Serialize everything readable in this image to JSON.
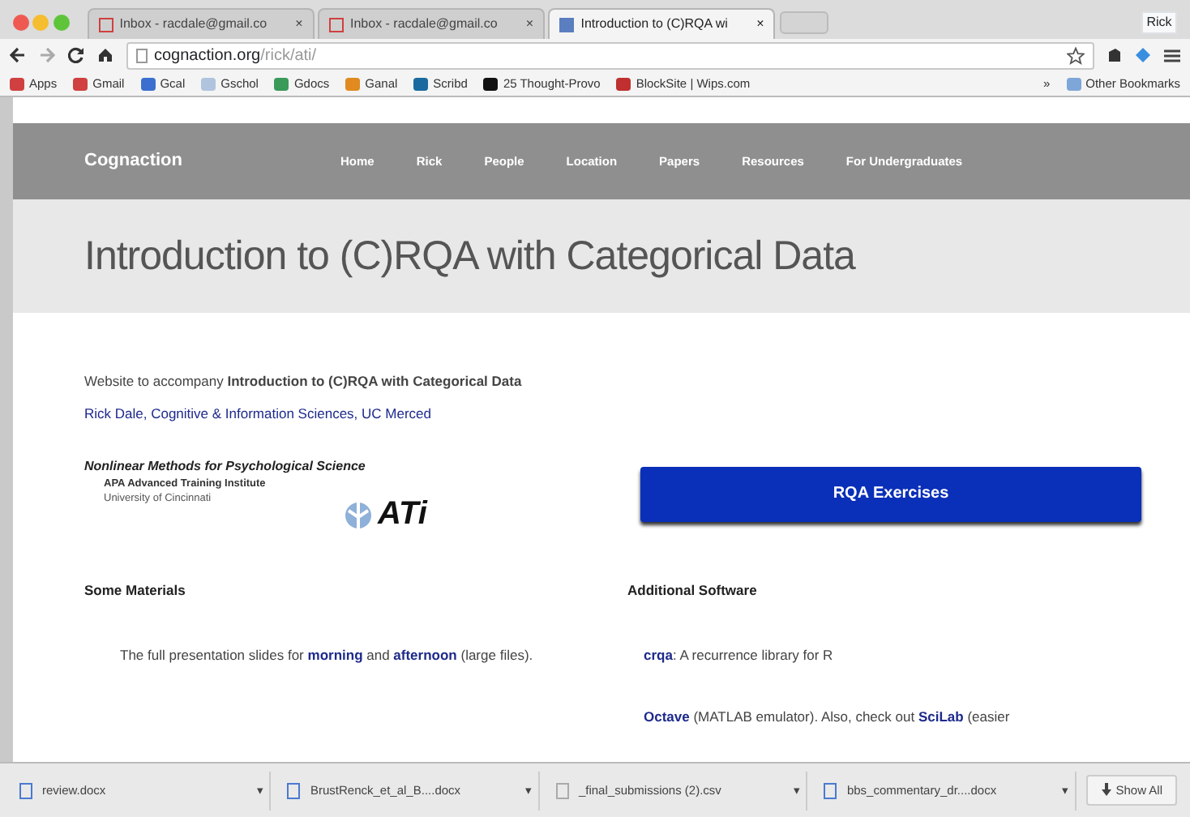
{
  "browser": {
    "tabs": [
      {
        "title": "Inbox - racdale@gmail.co",
        "kind": "mail",
        "selected": false
      },
      {
        "title": "Inbox - racdale@gmail.co",
        "kind": "mail",
        "selected": false
      },
      {
        "title": "Introduction to (C)RQA wi",
        "kind": "page",
        "selected": true
      }
    ],
    "tab_close": "×",
    "profile": "Rick",
    "url_host": "cognaction.org",
    "url_path": "/rick/ati/",
    "bookmarks": [
      {
        "label": "Apps",
        "color": "#d04040"
      },
      {
        "label": "Gmail",
        "color": "#d04040"
      },
      {
        "label": "Gcal",
        "color": "#3a6fd0"
      },
      {
        "label": "Gschol",
        "color": "#b0c4de"
      },
      {
        "label": "Gdocs",
        "color": "#3a9a5a"
      },
      {
        "label": "Ganal",
        "color": "#e08a20"
      },
      {
        "label": "Scribd",
        "color": "#1a6aa0"
      },
      {
        "label": "25 Thought-Provo",
        "color": "#111111"
      },
      {
        "label": "BlockSite | Wips.com",
        "color": "#c03030"
      }
    ],
    "more_bookmarks": "»",
    "other_bookmarks": "Other Bookmarks"
  },
  "site": {
    "brand": "Cognaction",
    "nav": [
      "Home",
      "Rick",
      "People",
      "Location",
      "Papers",
      "Resources",
      "For Undergraduates"
    ],
    "title": "Introduction to (C)RQA with Categorical Data",
    "intro": "Website to accompany **Introduction to (C)RQA with Categorical Data**",
    "author": "Rick Dale, Cognitive & Information Sciences, UC Merced",
    "logo": {
      "heading": "Nonlinear Methods for Psychological Science",
      "line1": "APA Advanced Training Institute",
      "line2": "University of Cincinnati",
      "mark": "ATi"
    },
    "button": "RQA Exercises",
    "sections": [
      {
        "heading": "Some Materials",
        "paragraphs": [
          [
            {
              "text": "The full presentation slides for ",
              "link": false
            },
            {
              "text": "morning",
              "link": true
            },
            {
              "text": " and ",
              "link": false
            },
            {
              "text": "afternoon",
              "link": true
            },
            {
              "text": " (large files).",
              "link": false
            }
          ]
        ]
      },
      {
        "heading": "Additional Software",
        "paragraphs": [
          [
            {
              "text": "crqa",
              "link": true
            },
            {
              "text": ": A recurrence library for R",
              "link": false
            }
          ],
          [
            {
              "text": "Octave",
              "link": true
            },
            {
              "text": " (MATLAB emulator). Also, check out ",
              "link": false
            },
            {
              "text": "SciLab",
              "link": true
            },
            {
              "text": " (easier",
              "link": false
            }
          ]
        ]
      }
    ]
  },
  "downloads": {
    "items": [
      {
        "name": "review.docx",
        "kind": "doc"
      },
      {
        "name": "BrustRenck_et_al_B....docx",
        "kind": "doc"
      },
      {
        "name": "_final_submissions (2).csv",
        "kind": "file"
      },
      {
        "name": "bbs_commentary_dr....docx",
        "kind": "doc"
      }
    ],
    "caret": "▾",
    "show_all": "Show All"
  }
}
